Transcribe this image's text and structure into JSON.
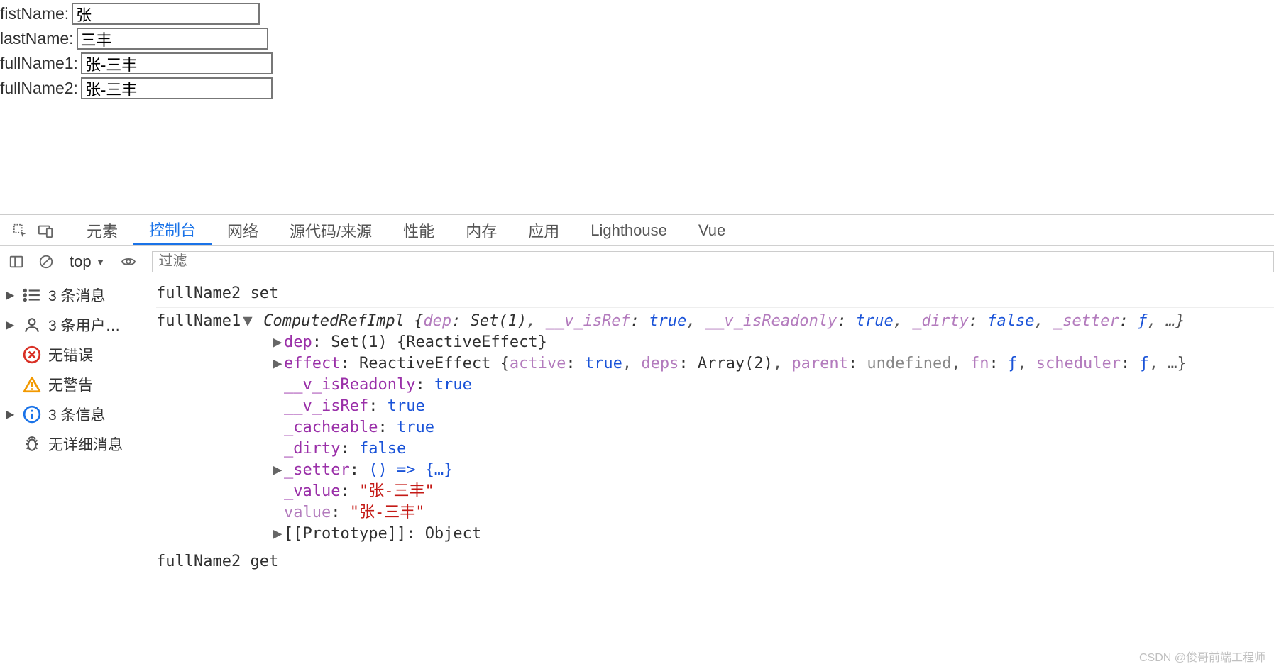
{
  "form": {
    "fields": [
      {
        "label": "fistName: ",
        "value": "张"
      },
      {
        "label": "lastName: ",
        "value": "三丰"
      },
      {
        "label": "fullName1: ",
        "value": "张-三丰"
      },
      {
        "label": "fullName2: ",
        "value": "张-三丰"
      }
    ]
  },
  "devtools": {
    "tabs": [
      "元素",
      "控制台",
      "网络",
      "源代码/来源",
      "性能",
      "内存",
      "应用",
      "Lighthouse",
      "Vue"
    ],
    "active_tab": "控制台",
    "toolbar": {
      "context": "top",
      "filter_placeholder": "过滤"
    },
    "sidebar": {
      "items": [
        {
          "label": "3 条消息",
          "icon": "list",
          "expandable": true
        },
        {
          "label": "3 条用户…",
          "icon": "user",
          "expandable": true
        },
        {
          "label": "无错误",
          "icon": "error",
          "expandable": false
        },
        {
          "label": "无警告",
          "icon": "warning",
          "expandable": false
        },
        {
          "label": "3 条信息",
          "icon": "info",
          "expandable": true
        },
        {
          "label": "无详细消息",
          "icon": "bug",
          "expandable": false
        }
      ]
    },
    "console": {
      "messages": [
        {
          "label": "fullName2 set"
        },
        {
          "label": "fullName1",
          "head_class": "ComputedRefImpl",
          "head_open": true,
          "head_props": [
            {
              "k": "dep",
              "v": "Set(1)",
              "t": "cls"
            },
            {
              "k": "__v_isRef",
              "v": "true",
              "t": "kw"
            },
            {
              "k": "__v_isReadonly",
              "v": "true",
              "t": "kw"
            },
            {
              "k": "_dirty",
              "v": "false",
              "t": "kw"
            },
            {
              "k": "_setter",
              "v": "ƒ",
              "t": "kw"
            }
          ],
          "body": [
            {
              "arrow": "▶",
              "prop": "dep",
              "after": ": Set(1) {ReactiveEffect}",
              "vals": []
            },
            {
              "arrow": "▶",
              "prop": "effect",
              "after_cls": "ReactiveEffect ",
              "vals": [
                {
                  "k": "active",
                  "v": "true",
                  "t": "kw"
                },
                {
                  "k": "deps",
                  "v": "Array(2)",
                  "t": "cls"
                },
                {
                  "k": "parent",
                  "v": "undefined",
                  "t": "dim"
                },
                {
                  "k": "fn",
                  "v": "ƒ",
                  "t": "kw"
                },
                {
                  "k": "scheduler",
                  "v": "ƒ",
                  "t": "kw"
                }
              ]
            },
            {
              "arrow": "",
              "prop": "__v_isReadonly",
              "v": "true",
              "t": "kw"
            },
            {
              "arrow": "",
              "prop": "__v_isRef",
              "v": "true",
              "t": "kw"
            },
            {
              "arrow": "",
              "prop": "_cacheable",
              "v": "true",
              "t": "kw"
            },
            {
              "arrow": "",
              "prop": "_dirty",
              "v": "false",
              "t": "kw"
            },
            {
              "arrow": "▶",
              "prop": "_setter",
              "v": "() => {…}",
              "t": "kw"
            },
            {
              "arrow": "",
              "prop": "_value",
              "v": "\"张-三丰\"",
              "t": "str"
            },
            {
              "arrow": "",
              "prop_dim": "value",
              "v": "\"张-三丰\"",
              "t": "str"
            },
            {
              "arrow": "▶",
              "prop_plain": "[[Prototype]]",
              "v": "Object",
              "t": "cls"
            }
          ]
        },
        {
          "label": "fullName2 get"
        }
      ]
    }
  },
  "watermark": "CSDN @俊哥前端工程师",
  "colors": {
    "active_tab": "#1a73e8",
    "prop": "#9a2fa8",
    "keyword": "#1a53d8",
    "string": "#c41a16",
    "error": "#d93025",
    "warning": "#f29900",
    "info": "#1a73e8"
  }
}
